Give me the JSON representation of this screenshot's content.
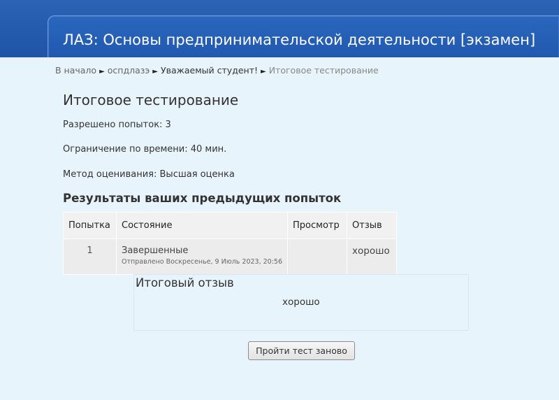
{
  "header": {
    "course_title": "ЛАЗ: Основы предпринимательской деятельности [экзамен]"
  },
  "breadcrumb": {
    "items": [
      "В начало",
      "оспдлазэ",
      "Уважаемый студент!",
      "Итоговое тестирование"
    ],
    "separator": "►"
  },
  "quiz": {
    "title": "Итоговое тестирование",
    "attempts_allowed": "Разрешено попыток: 3",
    "time_limit": "Ограничение по времени: 40 мин.",
    "grading_method": "Метод оценивания: Высшая оценка"
  },
  "results": {
    "section_title": "Результаты ваших предыдущих попыток",
    "columns": [
      "Попытка",
      "Состояние",
      "Просмотр",
      "Отзыв"
    ],
    "rows": [
      {
        "attempt": "1",
        "state": "Завершенные",
        "submitted": "Отправлено Воскресенье, 9 Июль 2023, 20:56",
        "review": "",
        "feedback": "хорошо"
      }
    ]
  },
  "overall_feedback": {
    "title": "Итоговый отзыв",
    "text": "хорошо"
  },
  "actions": {
    "retry_label": "Пройти тест заново"
  }
}
